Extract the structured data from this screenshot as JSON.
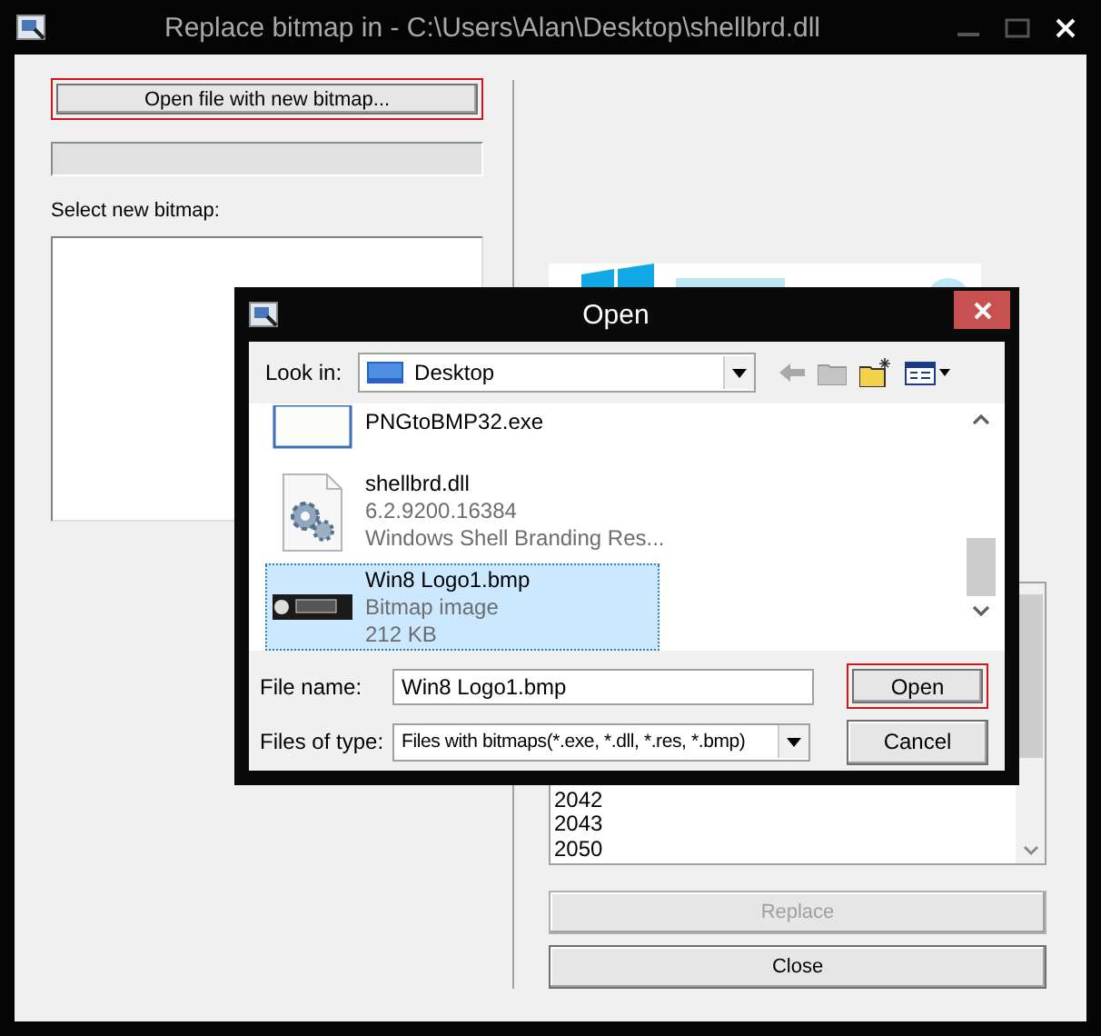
{
  "window": {
    "title": "Replace bitmap in - C:\\Users\\Alan\\Desktop\\shellbrd.dll"
  },
  "left_panel": {
    "open_button": {
      "label": "Open file with new bitmap...",
      "highlighted": true
    },
    "select_label": "Select new bitmap:"
  },
  "right_panel": {
    "resource_list": [
      "2042",
      "2043",
      "2050"
    ],
    "buttons": [
      {
        "label": "Replace",
        "disabled": true
      },
      {
        "label": "Close",
        "disabled": false
      }
    ]
  },
  "dialog": {
    "title": "Open",
    "look_in": {
      "label": "Look in:",
      "value": "Desktop"
    },
    "files": [
      {
        "name": "PNGtoBMP32.exe",
        "kind": "program",
        "selected": false
      },
      {
        "name": "shellbrd.dll",
        "details": [
          "6.2.9200.16384",
          "Windows Shell Branding Res..."
        ],
        "kind": "library",
        "selected": false
      },
      {
        "name": "Win8 Logo1.bmp",
        "details": [
          "Bitmap image",
          "212 KB"
        ],
        "kind": "bitmap",
        "selected": true
      }
    ],
    "file_name": {
      "label": "File name:",
      "value": "Win8 Logo1.bmp"
    },
    "file_type": {
      "label": "Files of type:",
      "value": "Files with bitmaps(*.exe, *.dll, *.res, *.bmp)"
    },
    "buttons": [
      {
        "label": "Open",
        "highlighted": true
      },
      {
        "label": "Cancel",
        "highlighted": false
      }
    ]
  }
}
